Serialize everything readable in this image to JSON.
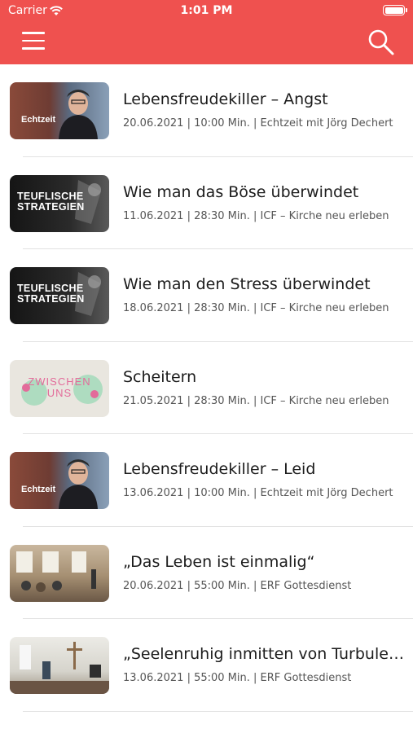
{
  "status_bar": {
    "carrier": "Carrier",
    "time": "1:01 PM"
  },
  "header": {
    "menu_icon": "hamburger-icon",
    "search_icon": "search-icon"
  },
  "colors": {
    "header": "#ef514f",
    "separator": "#e2e2e2",
    "meta": "#555555"
  },
  "items": [
    {
      "title": "Lebensfreudekiller – Angst",
      "meta": "20.06.2021 | 10:00 Min. | Echtzeit mit Jörg Dechert",
      "thumb_text": "Echtzeit"
    },
    {
      "title": "Wie man das Böse überwindet",
      "meta": "11.06.2021 | 28:30 Min. | ICF – Kirche neu erleben",
      "thumb_text": "TEUFLISCHE STRATEGIEN"
    },
    {
      "title": "Wie man den Stress  überwindet",
      "meta": "18.06.2021 | 28:30 Min. | ICF – Kirche neu erleben",
      "thumb_text": "TEUFLISCHE STRATEGIEN"
    },
    {
      "title": "Scheitern",
      "meta": "21.05.2021 | 28:30 Min. | ICF – Kirche neu erleben",
      "thumb_text": "ZWISCHEN UNS"
    },
    {
      "title": "Lebensfreudekiller – Leid",
      "meta": "13.06.2021 | 10:00 Min. | Echtzeit mit Jörg Dechert",
      "thumb_text": "Echtzeit"
    },
    {
      "title": "„Das Leben ist einmalig“",
      "meta": "20.06.2021 | 55:00 Min. | ERF Gottesdienst",
      "thumb_text": ""
    },
    {
      "title": "„Seelenruhig inmitten von Turbule…",
      "meta": "13.06.2021 | 55:00 Min. | ERF Gottesdienst",
      "thumb_text": ""
    }
  ]
}
